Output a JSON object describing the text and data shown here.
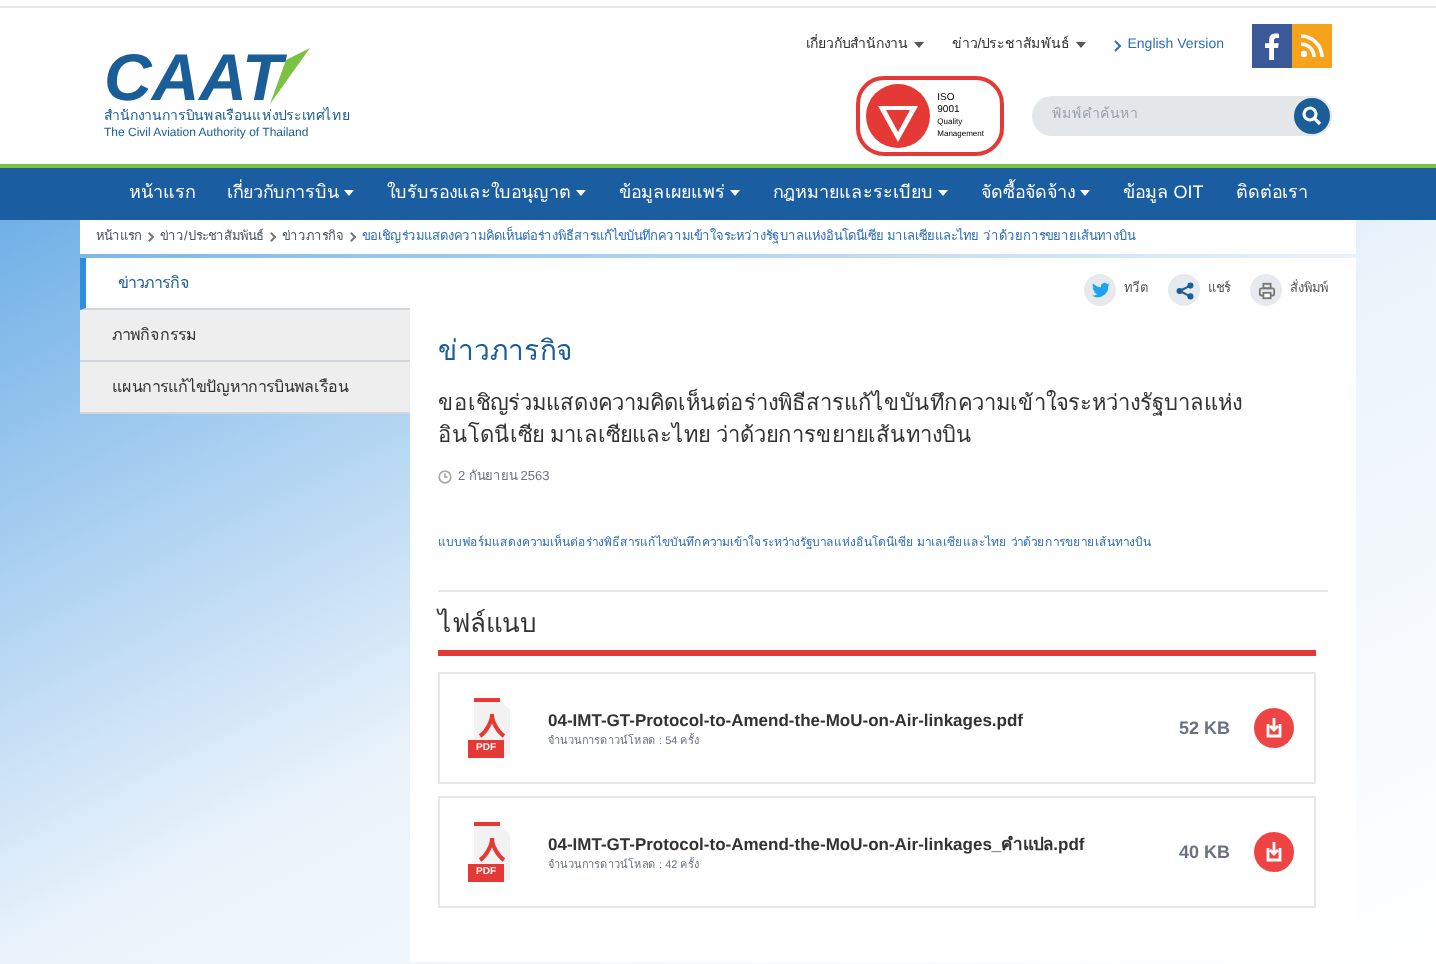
{
  "logo": {
    "mark": "CAAT",
    "name_th": "สำนักงานการบินพลเรือนแห่งประเทศไทย",
    "name_en": "The Civil Aviation Authority of Thailand"
  },
  "top_links": [
    {
      "label": "เกี่ยวกับสำนักงาน",
      "kind": "dropdown"
    },
    {
      "label": "ข่าว/ประชาสัมพันธ์",
      "kind": "dropdown"
    },
    {
      "label": "English Version",
      "kind": "link"
    }
  ],
  "iso_badge": [
    "ISO",
    "9001",
    "Quality",
    "Management"
  ],
  "search": {
    "placeholder": "พิมพ์คำค้นหา"
  },
  "nav": [
    {
      "label": "หน้าแรก",
      "dropdown": false
    },
    {
      "label": "เกี่ยวกับการบิน",
      "dropdown": true
    },
    {
      "label": "ใบรับรองและใบอนุญาต",
      "dropdown": true
    },
    {
      "label": "ข้อมูลเผยแพร่",
      "dropdown": true
    },
    {
      "label": "กฎหมายและระเบียบ",
      "dropdown": true
    },
    {
      "label": "จัดซื้อจัดจ้าง",
      "dropdown": true
    },
    {
      "label": "ข้อมูล OIT",
      "dropdown": false
    },
    {
      "label": "ติดต่อเรา",
      "dropdown": false
    }
  ],
  "breadcrumb": [
    "หน้าแรก",
    "ข่าว/ประชาสัมพันธ์",
    "ข่าวภารกิจ",
    "ขอเชิญร่วมแสดงความคิดเห็นต่อร่างพิธีสารแก้ไขบันทึกความเข้าใจระหว่างรัฐบาลแห่งอินโดนีเซีย มาเลเซียและไทย ว่าด้วยการขยายเส้นทางบิน"
  ],
  "sidebar": {
    "items": [
      {
        "label": "ข่าวภารกิจ",
        "selected": true
      },
      {
        "label": "ภาพกิจกรรม",
        "selected": false
      },
      {
        "label": "แผนการแก้ไขปัญหาการบินพลเรือน",
        "selected": false
      }
    ]
  },
  "share": [
    {
      "kind": "tweet",
      "label": "ทวีต"
    },
    {
      "kind": "share",
      "label": "แชร์"
    },
    {
      "kind": "print",
      "label": "สั่งพิมพ์"
    }
  ],
  "article": {
    "section": "ข่าวภารกิจ",
    "title": "ขอเชิญร่วมแสดงความคิดเห็นต่อร่างพิธีสารแก้ไขบันทึกความเข้าใจระหว่างรัฐบาลแห่งอินโดนีเซีย มาเลเซียและไทย ว่าด้วยการขยายเส้นทางบิน",
    "date": "2 กันยายน 2563",
    "link": "แบบฟอร์มแสดงความเห็นต่อร่างพิธีสารแก้ไขบันทึกความเข้าใจระหว่างรัฐบาลแห่งอินโดนีเซีย มาเลเซียและไทย ว่าด้วยการขยายเส้นทางบิน"
  },
  "attachments": {
    "title": "ไฟล์แนบ",
    "files": [
      {
        "name": "04-IMT-GT-Protocol-to-Amend-the-MoU-on-Air-linkages.pdf",
        "icon_label": "PDF",
        "downloads": "จำนวนการดาวน์โหลด : 54 ครั้ง",
        "size": "52 KB"
      },
      {
        "name": "04-IMT-GT-Protocol-to-Amend-the-MoU-on-Air-linkages_คำแปล.pdf",
        "icon_label": "PDF",
        "downloads": "จำนวนการดาวน์โหลด : 42 ครั้ง",
        "size": "40 KB"
      }
    ]
  }
}
